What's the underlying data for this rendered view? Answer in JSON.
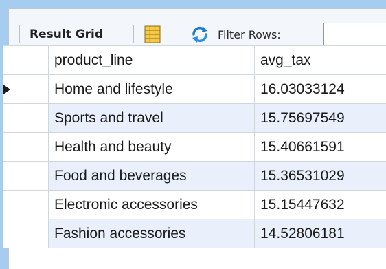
{
  "toolbar": {
    "result_grid_label": "Result Grid",
    "filter_label": "Filter Rows:",
    "filter_value": "",
    "icons": [
      "grid-view-icon",
      "refresh-icon"
    ]
  },
  "grid": {
    "columns": [
      "product_line",
      "avg_tax"
    ],
    "rows": [
      {
        "product_line": "Home and lifestyle",
        "avg_tax": "16.03033124"
      },
      {
        "product_line": "Sports and travel",
        "avg_tax": "15.75697549"
      },
      {
        "product_line": "Health and beauty",
        "avg_tax": "15.40661591"
      },
      {
        "product_line": "Food and beverages",
        "avg_tax": "15.36531029"
      },
      {
        "product_line": "Electronic accessories",
        "avg_tax": "15.15447632"
      },
      {
        "product_line": "Fashion accessories",
        "avg_tax": "14.52806181"
      }
    ],
    "current_row": 0
  },
  "colors": {
    "background": "#a6cdf0",
    "alt_row": "#e9f0fb",
    "grid_line": "#cfd6de",
    "refresh_blue": "#1f78c8"
  }
}
